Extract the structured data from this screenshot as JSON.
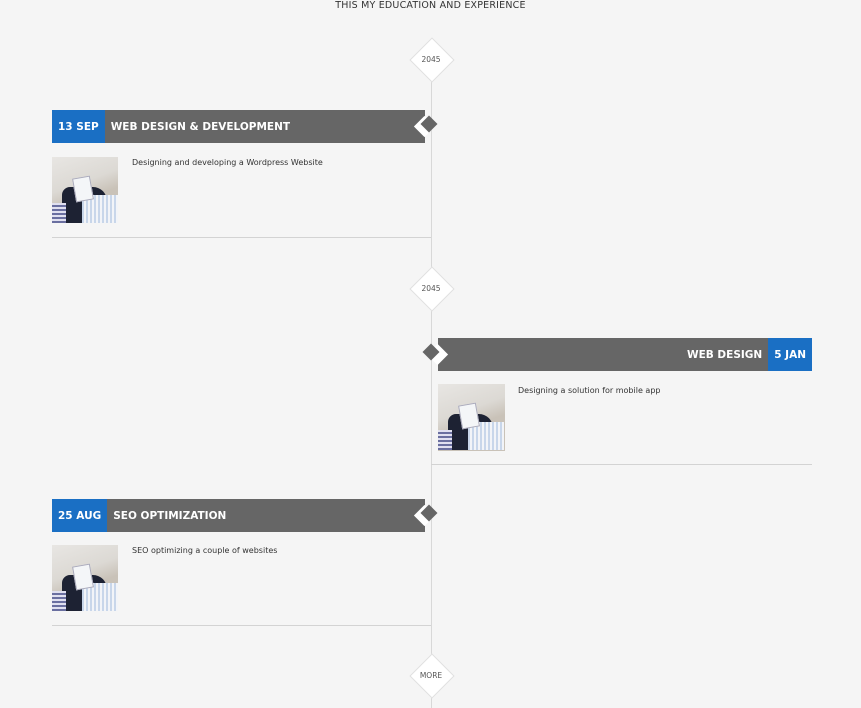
{
  "section": {
    "subtitle": "THIS MY EDUCATION AND EXPERIENCE"
  },
  "timeline": {
    "markers": [
      "2045",
      "2045",
      "MORE"
    ],
    "entries": [
      {
        "date": "13 SEP",
        "title": "WEB DESIGN & DEVELOPMENT",
        "description": "Designing and developing a Wordpress Website",
        "side": "left"
      },
      {
        "date": "5 JAN",
        "title": "WEB DESIGN",
        "description": "Designing a solution for mobile app",
        "side": "right"
      },
      {
        "date": "25 AUG",
        "title": "SEO OPTIMIZATION",
        "description": "SEO optimizing a couple of websites",
        "side": "left"
      }
    ]
  },
  "colors": {
    "accent": "#1a6fc4",
    "header": "#666666",
    "background": "#f5f5f5"
  }
}
